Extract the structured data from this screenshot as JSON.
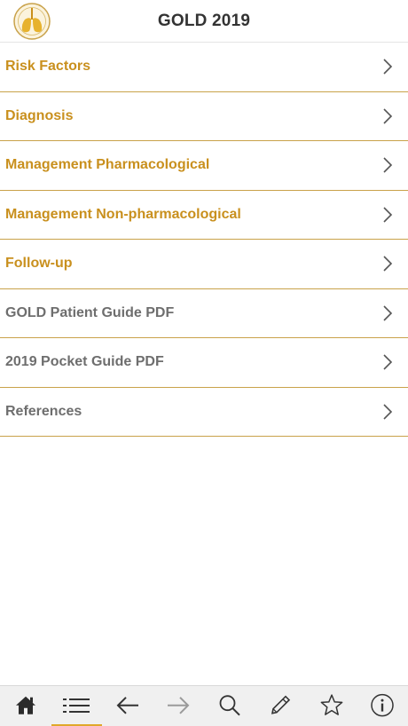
{
  "header": {
    "title": "GOLD 2019",
    "logo_icon": "gold-lungs-logo"
  },
  "menu": {
    "items": [
      {
        "label": "Risk Factors",
        "style": "gold"
      },
      {
        "label": "Diagnosis",
        "style": "gold"
      },
      {
        "label": "Management Pharmacological",
        "style": "gold"
      },
      {
        "label": "Management Non-pharmacological",
        "style": "gold"
      },
      {
        "label": "Follow-up",
        "style": "gold"
      },
      {
        "label": "GOLD Patient Guide PDF",
        "style": "gray"
      },
      {
        "label": "2019 Pocket Guide PDF",
        "style": "gray"
      },
      {
        "label": "References",
        "style": "gray"
      }
    ]
  },
  "toolbar": {
    "items": [
      {
        "icon": "home-icon"
      },
      {
        "icon": "list-icon",
        "active": true
      },
      {
        "icon": "back-arrow-icon"
      },
      {
        "icon": "forward-arrow-icon",
        "disabled": true
      },
      {
        "icon": "search-icon"
      },
      {
        "icon": "pencil-icon"
      },
      {
        "icon": "star-icon"
      },
      {
        "icon": "info-icon"
      }
    ]
  },
  "colors": {
    "gold_text": "#c9901e",
    "gray_text": "#6e6e6e",
    "divider": "#c9a24a",
    "active_indicator": "#e0a82a",
    "toolbar_bg": "#f0f0f0"
  }
}
